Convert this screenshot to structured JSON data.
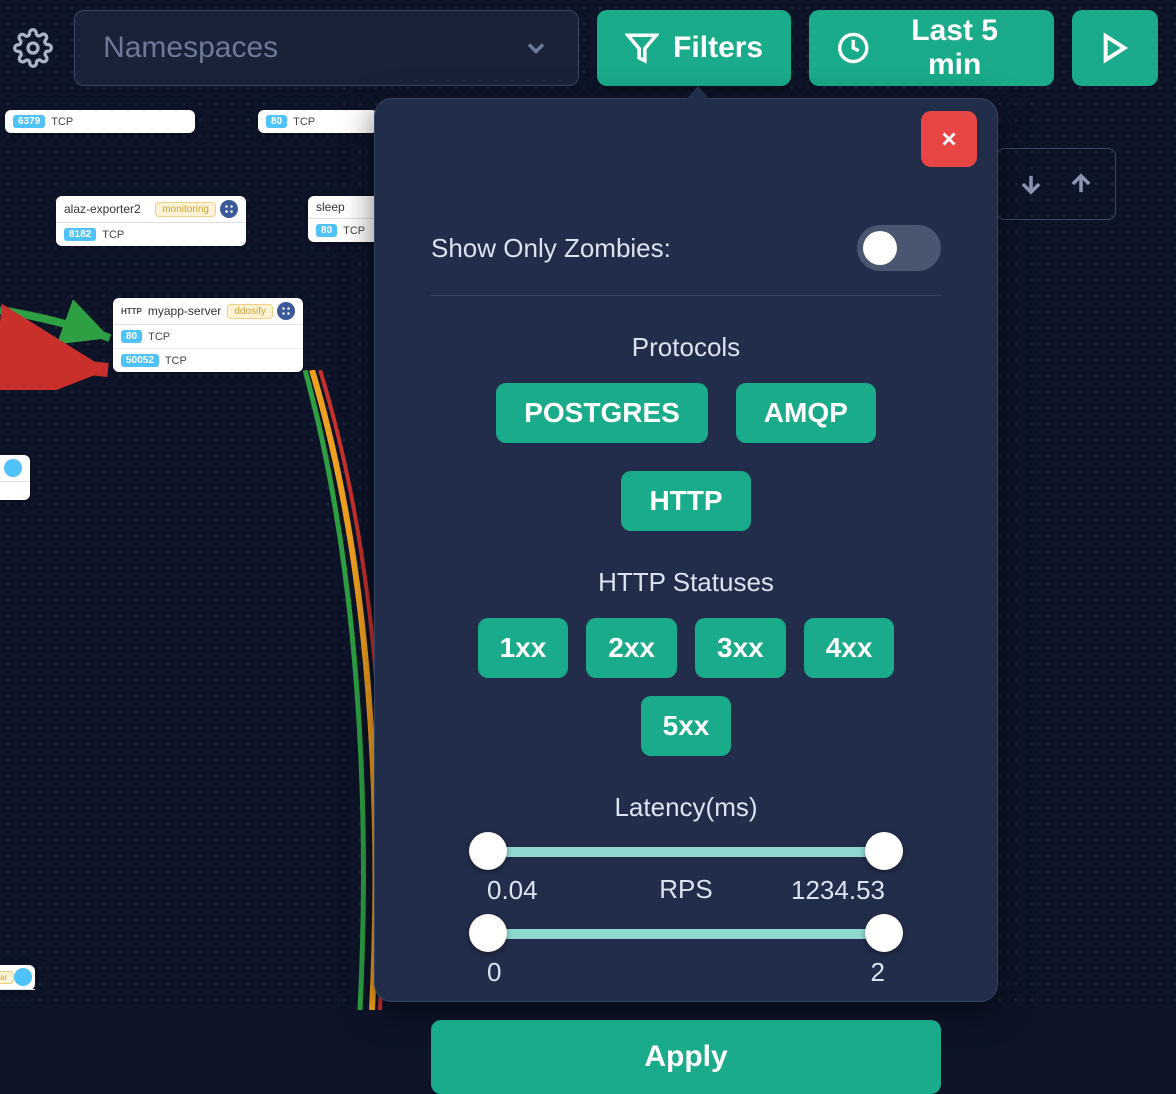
{
  "toolbar": {
    "namespace_placeholder": "Namespaces",
    "filters_label": "Filters",
    "time_label": "Last 5 min"
  },
  "nodes": {
    "n1_port": "6379",
    "n1_proto": "TCP",
    "n2_port": "80",
    "n2_proto": "TCP",
    "alaz_title": "alaz-exporter2",
    "alaz_badge": "monitoring",
    "alaz_port": "8182",
    "alaz_proto": "TCP",
    "sleep_title": "sleep",
    "sleep_port": "80",
    "sleep_proto": "TCP",
    "myapp_http": "HTTP",
    "myapp_title": "myapp-server",
    "myapp_badge": "ddosify",
    "myapp_p1": "80",
    "myapp_p1_proto": "TCP",
    "myapp_p2": "50052",
    "myapp_p2_proto": "TCP"
  },
  "modal": {
    "zombies_label": "Show Only Zombies:",
    "protocols_title": "Protocols",
    "protocols": [
      "POSTGRES",
      "AMQP",
      "HTTP"
    ],
    "statuses_title": "HTTP Statuses",
    "statuses": [
      "1xx",
      "2xx",
      "3xx",
      "4xx",
      "5xx"
    ],
    "latency_title": "Latency(ms)",
    "latency_min": "0.04",
    "latency_max": "1234.53",
    "rps_title": "RPS",
    "rps_min": "0",
    "rps_max": "2",
    "apply_label": "Apply"
  }
}
